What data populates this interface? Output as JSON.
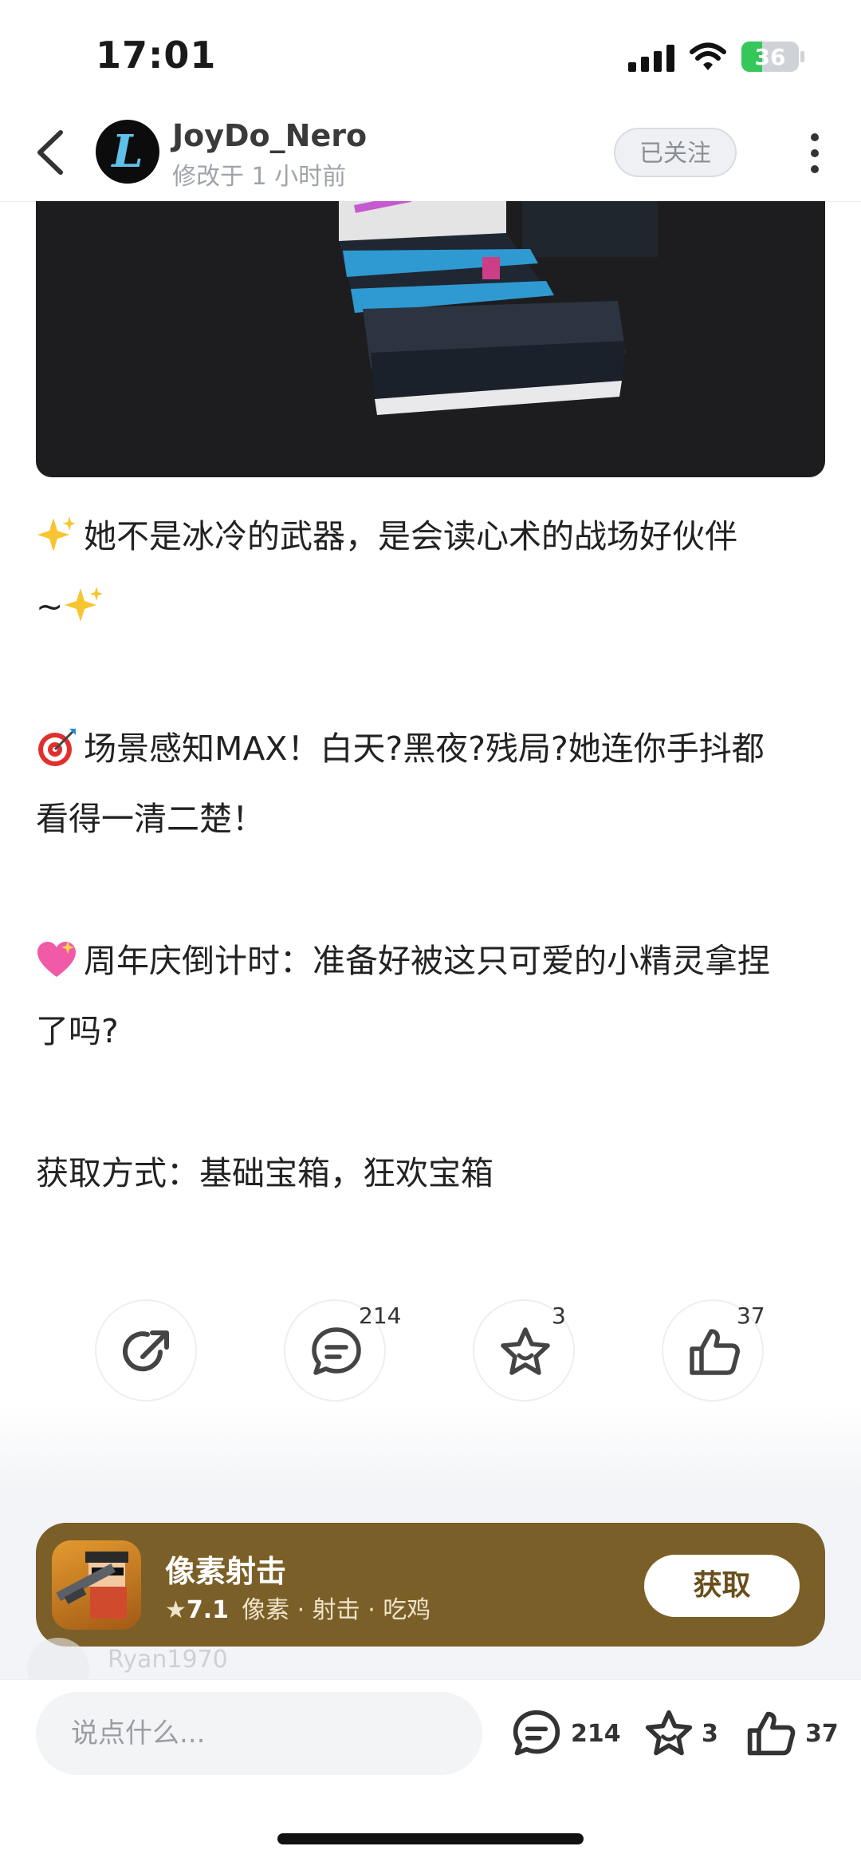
{
  "status_bar": {
    "time": "17:01",
    "battery": "36"
  },
  "header": {
    "avatar_letter": "L",
    "author": "JoyDo_Nero",
    "subtitle": "修改于 1 小时前",
    "follow_label": "已关注"
  },
  "post": {
    "paragraphs": [
      {
        "emoji": "sparkles-icon",
        "line1": "她不是冰冷的武器，是会读心术的战场好伙伴",
        "line2": "~"
      },
      {
        "emoji": "target-icon",
        "line1": "场景感知MAX！白天?黑夜?残局?她连你手抖都",
        "line2": "看得一清二楚！"
      },
      {
        "emoji": "heart-icon",
        "line1": "周年庆倒计时：准备好被这只可爱的小精灵拿捏",
        "line2": "了吗?"
      },
      {
        "line1": "获取方式：基础宝箱，狂欢宝箱"
      }
    ]
  },
  "actions": {
    "comment_count": "214",
    "favorite_count": "3",
    "like_count": "37"
  },
  "game_card": {
    "title": "像素射击",
    "rating": "7.1",
    "tags": "像素 · 射击 · 吃鸡",
    "get_label": "获取",
    "accent": "#7b5f28"
  },
  "comment_preview": {
    "username": "Ryan1970"
  },
  "bottom_bar": {
    "input_placeholder": "说点什么...",
    "comment_count": "214",
    "favorite_count": "3",
    "like_count": "37"
  }
}
